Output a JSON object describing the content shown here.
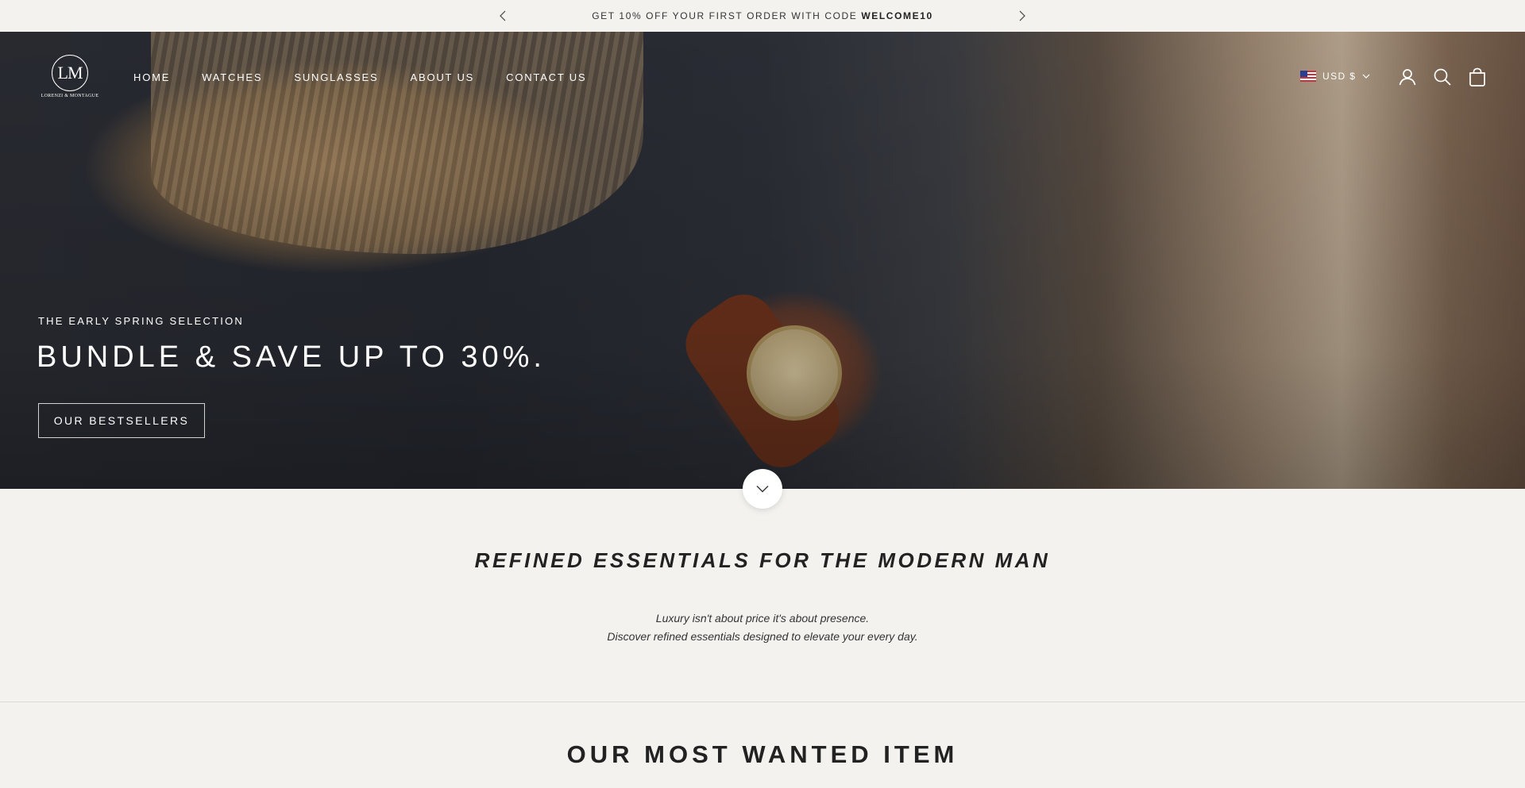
{
  "announcement": {
    "text": "GET 10% OFF YOUR FIRST ORDER WITH CODE ",
    "code": "WELCOME10"
  },
  "brand": {
    "monogram": "LM",
    "name": "LORENZI & MONTAGUE"
  },
  "nav": {
    "items": [
      {
        "label": "HOME"
      },
      {
        "label": "WATCHES"
      },
      {
        "label": "SUNGLASSES"
      },
      {
        "label": "ABOUT US"
      },
      {
        "label": "CONTACT US"
      }
    ]
  },
  "header": {
    "currency": "USD $",
    "icons": [
      "account-icon",
      "search-icon",
      "cart-icon"
    ]
  },
  "hero": {
    "eyebrow": "THE EARLY SPRING SELECTION",
    "headline": "BUNDLE & SAVE UP TO 30%.",
    "button": "OUR BESTSELLERS"
  },
  "intro": {
    "title": "REFINED ESSENTIALS FOR THE MODERN MAN",
    "line1": "Luxury isn't about price it's about presence.",
    "line2": "Discover refined essentials designed to elevate your every day."
  },
  "featured": {
    "title": "OUR MOST WANTED ITEM"
  },
  "colors": {
    "background": "#f3f2ef",
    "text": "#222222",
    "hero_text": "#ffffff"
  }
}
